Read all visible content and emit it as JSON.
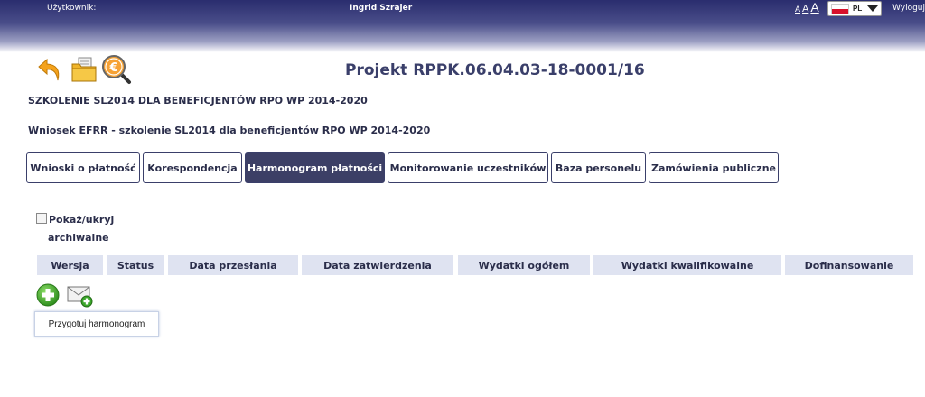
{
  "header": {
    "user_label": "Użytkownik:",
    "user_name": "Ingrid Szrajer",
    "font_small": "A",
    "font_medium": "A",
    "font_large": "A",
    "language": "PL",
    "logout": "Wyloguj"
  },
  "project": {
    "title": "Projekt RPPK.06.04.03-18-0001/16",
    "program": "SZKOLENIE SL2014 DLA BENEFICJENTÓW RPO WP 2014-2020",
    "application": "Wniosek EFRR - szkolenie SL2014 dla beneficjentów RPO WP 2014-2020"
  },
  "toolbar_icons": [
    "back-arrow-icon",
    "folder-documents-icon",
    "euro-search-icon"
  ],
  "tabs": [
    {
      "label": "Wnioski o płatność",
      "active": false
    },
    {
      "label": "Korespondencja",
      "active": false
    },
    {
      "label": "Harmonogram płatności",
      "active": true
    },
    {
      "label": "Monitorowanie uczestników",
      "active": false
    },
    {
      "label": "Baza personelu",
      "active": false
    },
    {
      "label": "Zamówienia publiczne",
      "active": false
    }
  ],
  "archive_toggle": {
    "label_line1": "Pokaż/ukryj",
    "label_line2": "archiwalne",
    "checked": false
  },
  "table": {
    "columns": [
      "Wersja",
      "Status",
      "Data przesłania",
      "Data zatwierdzenia",
      "Wydatki ogółem",
      "Wydatki kwalifikowalne",
      "Dofinansowanie"
    ]
  },
  "actions": {
    "add_icon": "add-circle-icon",
    "mail_icon": "envelope-add-icon",
    "tooltip": "Przygotuj harmonogram"
  },
  "colors": {
    "header_dark": "#2a2d6e",
    "tab_active": "#3c3f66",
    "table_header": "#dfe3f1",
    "add_green": "#3aa62a"
  }
}
